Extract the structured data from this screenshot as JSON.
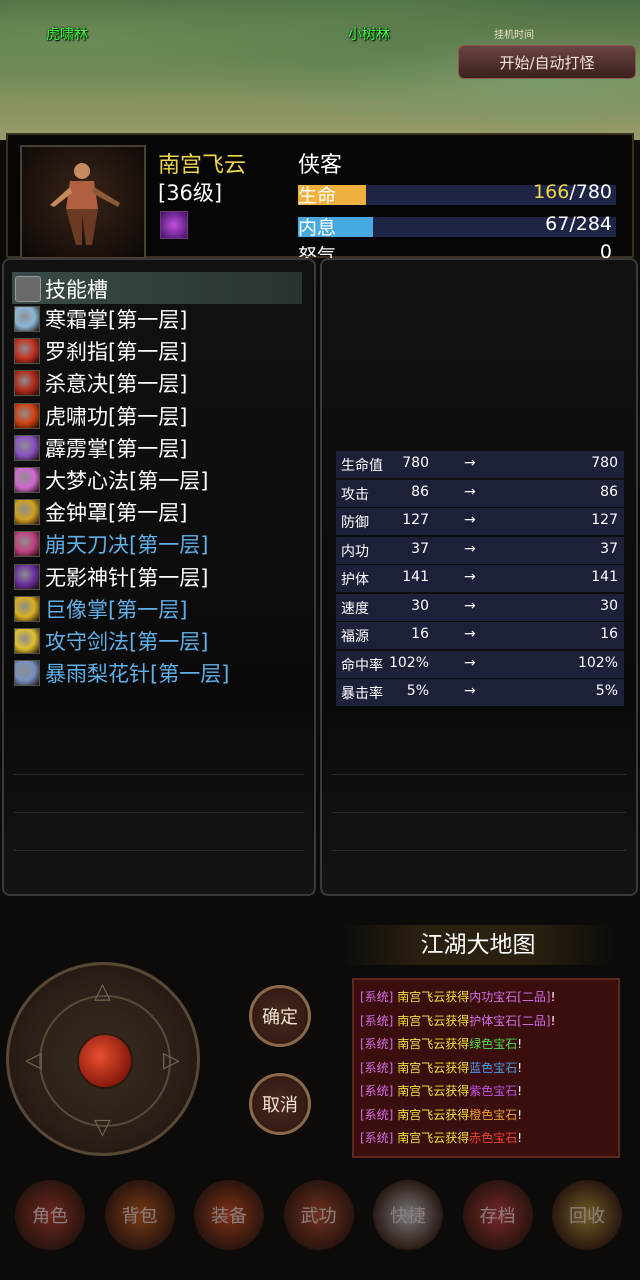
{
  "map": {
    "labels": [
      "虎啸林",
      "小树林"
    ],
    "auto_label_small": "挂机时间",
    "auto_button": "开始/自动打怪"
  },
  "character": {
    "name": "南宫飞云",
    "class": "侠客",
    "level": "[36级]",
    "hp_label": "生命",
    "hp_current": "166",
    "hp_max": "/780",
    "hp_fraction": 0.213,
    "mp_label": "内息",
    "mp_value": "67/284",
    "mp_fraction": 0.236,
    "rage_label": "怒气",
    "rage_value": "0"
  },
  "skills": {
    "header": "技能槽",
    "items": [
      {
        "name": "寒霜掌[第一层]",
        "color": "#ffffff",
        "icon": "frost-palm-icon"
      },
      {
        "name": "罗刹指[第一层]",
        "color": "#ffffff",
        "icon": "rakshasa-finger-icon"
      },
      {
        "name": "杀意决[第一层]",
        "color": "#ffffff",
        "icon": "killing-intent-icon"
      },
      {
        "name": "虎啸功[第一层]",
        "color": "#ffffff",
        "icon": "tiger-roar-icon"
      },
      {
        "name": "霹雳掌[第一层]",
        "color": "#ffffff",
        "icon": "thunder-palm-icon"
      },
      {
        "name": "大梦心法[第一层]",
        "color": "#ffffff",
        "icon": "dream-heart-icon"
      },
      {
        "name": "金钟罩[第一层]",
        "color": "#ffffff",
        "icon": "golden-bell-icon"
      },
      {
        "name": "崩天刀决[第一层]",
        "color": "#5fb0e8",
        "icon": "sky-blade-icon"
      },
      {
        "name": "无影神针[第一层]",
        "color": "#ffffff",
        "icon": "shadow-needle-icon"
      },
      {
        "name": "巨像掌[第一层]",
        "color": "#5fb0e8",
        "icon": "colossus-palm-icon"
      },
      {
        "name": "攻守剑法[第一层]",
        "color": "#5fb0e8",
        "icon": "sword-art-icon"
      },
      {
        "name": "暴雨梨花针[第一层]",
        "color": "#5fb0e8",
        "icon": "rain-needle-icon"
      }
    ]
  },
  "stats": [
    {
      "name": "生命值",
      "value": "780",
      "arrow": "→",
      "new": "780"
    },
    {
      "name": "攻击",
      "value": "86",
      "arrow": "→",
      "new": "86"
    },
    {
      "name": "防御",
      "value": "127",
      "arrow": "→",
      "new": "127"
    },
    {
      "name": "内功",
      "value": "37",
      "arrow": "→",
      "new": "37"
    },
    {
      "name": "护体",
      "value": "141",
      "arrow": "→",
      "new": "141"
    },
    {
      "name": "速度",
      "value": "30",
      "arrow": "→",
      "new": "30"
    },
    {
      "name": "福源",
      "value": "16",
      "arrow": "→",
      "new": "16"
    },
    {
      "name": "命中率",
      "value": "102%",
      "arrow": "→",
      "new": "102%"
    },
    {
      "name": "暴击率",
      "value": "5%",
      "arrow": "→",
      "new": "5%"
    }
  ],
  "region_title": "江湖大地图",
  "log": {
    "tag": "[系统]",
    "player": "南宫飞云获得",
    "lines": [
      {
        "item": "内功宝石[二品]",
        "end": "!",
        "color": "#d46ae8"
      },
      {
        "item": "护体宝石[二品]",
        "end": "!",
        "color": "#d46ae8"
      },
      {
        "item": "绿色宝石",
        "end": "!",
        "color": "#4ae04a"
      },
      {
        "item": "蓝色宝石",
        "end": "!",
        "color": "#4a9ae8"
      },
      {
        "item": "紫色宝石",
        "end": "!",
        "color": "#c050e8"
      },
      {
        "item": "橙色宝石",
        "end": "!",
        "color": "#f0a030"
      },
      {
        "item": "赤色宝石",
        "end": "!",
        "color": "#f04030"
      }
    ]
  },
  "controls": {
    "confirm": "确定",
    "cancel": "取消"
  },
  "menu": [
    "角色",
    "背包",
    "装备",
    "武功",
    "快捷",
    "存档",
    "回收"
  ],
  "colors": {
    "name_gold": "#f0d64a",
    "hp_fill": "#f0b040",
    "mp_fill": "#48a8e0",
    "system_tag": "#d46ae8",
    "log_player": "#f0e040"
  }
}
